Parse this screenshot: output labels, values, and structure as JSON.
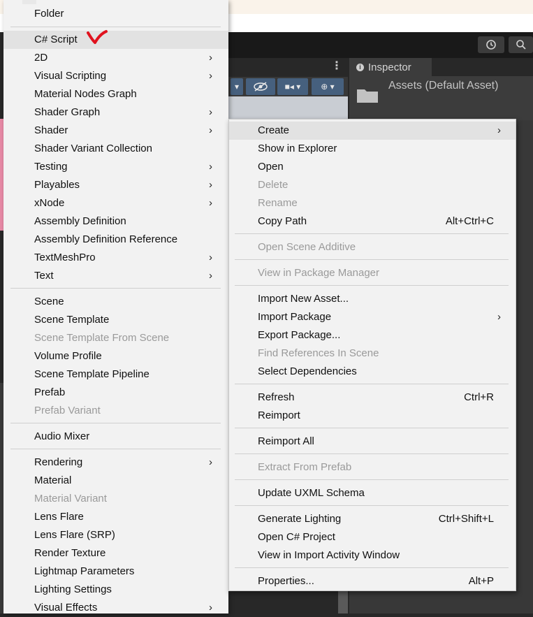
{
  "inspector": {
    "tab_label": "Inspector",
    "asset_title": "Assets (Default Asset)"
  },
  "left_menu": {
    "items": [
      {
        "label": "Folder",
        "submenu": false,
        "disabled": false
      },
      {
        "label": "C# Script",
        "submenu": false,
        "disabled": false,
        "highlighted": true
      },
      {
        "label": "2D",
        "submenu": true,
        "disabled": false
      },
      {
        "label": "Visual Scripting",
        "submenu": true,
        "disabled": false
      },
      {
        "label": "Material Nodes Graph",
        "submenu": false,
        "disabled": false
      },
      {
        "label": "Shader Graph",
        "submenu": true,
        "disabled": false
      },
      {
        "label": "Shader",
        "submenu": true,
        "disabled": false
      },
      {
        "label": "Shader Variant Collection",
        "submenu": false,
        "disabled": false
      },
      {
        "label": "Testing",
        "submenu": true,
        "disabled": false
      },
      {
        "label": "Playables",
        "submenu": true,
        "disabled": false
      },
      {
        "label": "xNode",
        "submenu": true,
        "disabled": false
      },
      {
        "label": "Assembly Definition",
        "submenu": false,
        "disabled": false
      },
      {
        "label": "Assembly Definition Reference",
        "submenu": false,
        "disabled": false
      },
      {
        "label": "TextMeshPro",
        "submenu": true,
        "disabled": false
      },
      {
        "label": "Text",
        "submenu": true,
        "disabled": false
      },
      {
        "label": "Scene",
        "submenu": false,
        "disabled": false
      },
      {
        "label": "Scene Template",
        "submenu": false,
        "disabled": false
      },
      {
        "label": "Scene Template From Scene",
        "submenu": false,
        "disabled": true
      },
      {
        "label": "Volume Profile",
        "submenu": false,
        "disabled": false
      },
      {
        "label": "Scene Template Pipeline",
        "submenu": false,
        "disabled": false
      },
      {
        "label": "Prefab",
        "submenu": false,
        "disabled": false
      },
      {
        "label": "Prefab Variant",
        "submenu": false,
        "disabled": true
      },
      {
        "label": "Audio Mixer",
        "submenu": false,
        "disabled": false
      },
      {
        "label": "Rendering",
        "submenu": true,
        "disabled": false
      },
      {
        "label": "Material",
        "submenu": false,
        "disabled": false
      },
      {
        "label": "Material Variant",
        "submenu": false,
        "disabled": true
      },
      {
        "label": "Lens Flare",
        "submenu": false,
        "disabled": false
      },
      {
        "label": "Lens Flare (SRP)",
        "submenu": false,
        "disabled": false
      },
      {
        "label": "Render Texture",
        "submenu": false,
        "disabled": false
      },
      {
        "label": "Lightmap Parameters",
        "submenu": false,
        "disabled": false
      },
      {
        "label": "Lighting Settings",
        "submenu": false,
        "disabled": false
      },
      {
        "label": "Visual Effects",
        "submenu": true,
        "disabled": false
      }
    ]
  },
  "right_menu": {
    "items": [
      {
        "label": "Create",
        "submenu": true,
        "disabled": false,
        "highlighted": true,
        "shortcut": ""
      },
      {
        "label": "Show in Explorer",
        "submenu": false,
        "disabled": false,
        "shortcut": ""
      },
      {
        "label": "Open",
        "submenu": false,
        "disabled": false,
        "shortcut": ""
      },
      {
        "label": "Delete",
        "submenu": false,
        "disabled": true,
        "shortcut": ""
      },
      {
        "label": "Rename",
        "submenu": false,
        "disabled": true,
        "shortcut": ""
      },
      {
        "label": "Copy Path",
        "submenu": false,
        "disabled": false,
        "shortcut": "Alt+Ctrl+C"
      },
      {
        "label": "Open Scene Additive",
        "submenu": false,
        "disabled": true,
        "shortcut": ""
      },
      {
        "label": "View in Package Manager",
        "submenu": false,
        "disabled": true,
        "shortcut": ""
      },
      {
        "label": "Import New Asset...",
        "submenu": false,
        "disabled": false,
        "shortcut": ""
      },
      {
        "label": "Import Package",
        "submenu": true,
        "disabled": false,
        "shortcut": ""
      },
      {
        "label": "Export Package...",
        "submenu": false,
        "disabled": false,
        "shortcut": ""
      },
      {
        "label": "Find References In Scene",
        "submenu": false,
        "disabled": true,
        "shortcut": ""
      },
      {
        "label": "Select Dependencies",
        "submenu": false,
        "disabled": false,
        "shortcut": ""
      },
      {
        "label": "Refresh",
        "submenu": false,
        "disabled": false,
        "shortcut": "Ctrl+R"
      },
      {
        "label": "Reimport",
        "submenu": false,
        "disabled": false,
        "shortcut": ""
      },
      {
        "label": "Reimport All",
        "submenu": false,
        "disabled": false,
        "shortcut": ""
      },
      {
        "label": "Extract From Prefab",
        "submenu": false,
        "disabled": true,
        "shortcut": ""
      },
      {
        "label": "Update UXML Schema",
        "submenu": false,
        "disabled": false,
        "shortcut": ""
      },
      {
        "label": "Generate Lighting",
        "submenu": false,
        "disabled": false,
        "shortcut": "Ctrl+Shift+L"
      },
      {
        "label": "Open C# Project",
        "submenu": false,
        "disabled": false,
        "shortcut": ""
      },
      {
        "label": "View in Import Activity Window",
        "submenu": false,
        "disabled": false,
        "shortcut": ""
      },
      {
        "label": "Properties...",
        "submenu": false,
        "disabled": false,
        "shortcut": "Alt+P"
      }
    ]
  },
  "icons": {
    "history": "history-icon",
    "search": "search-icon",
    "submenu": "chevron-right-icon",
    "annotation": "red-checkmark"
  },
  "colors": {
    "menu_bg": "#f2f2f2",
    "highlight": "#e2e2e2",
    "disabled_text": "#9a9a9a",
    "annotation_red": "#e0121e"
  }
}
